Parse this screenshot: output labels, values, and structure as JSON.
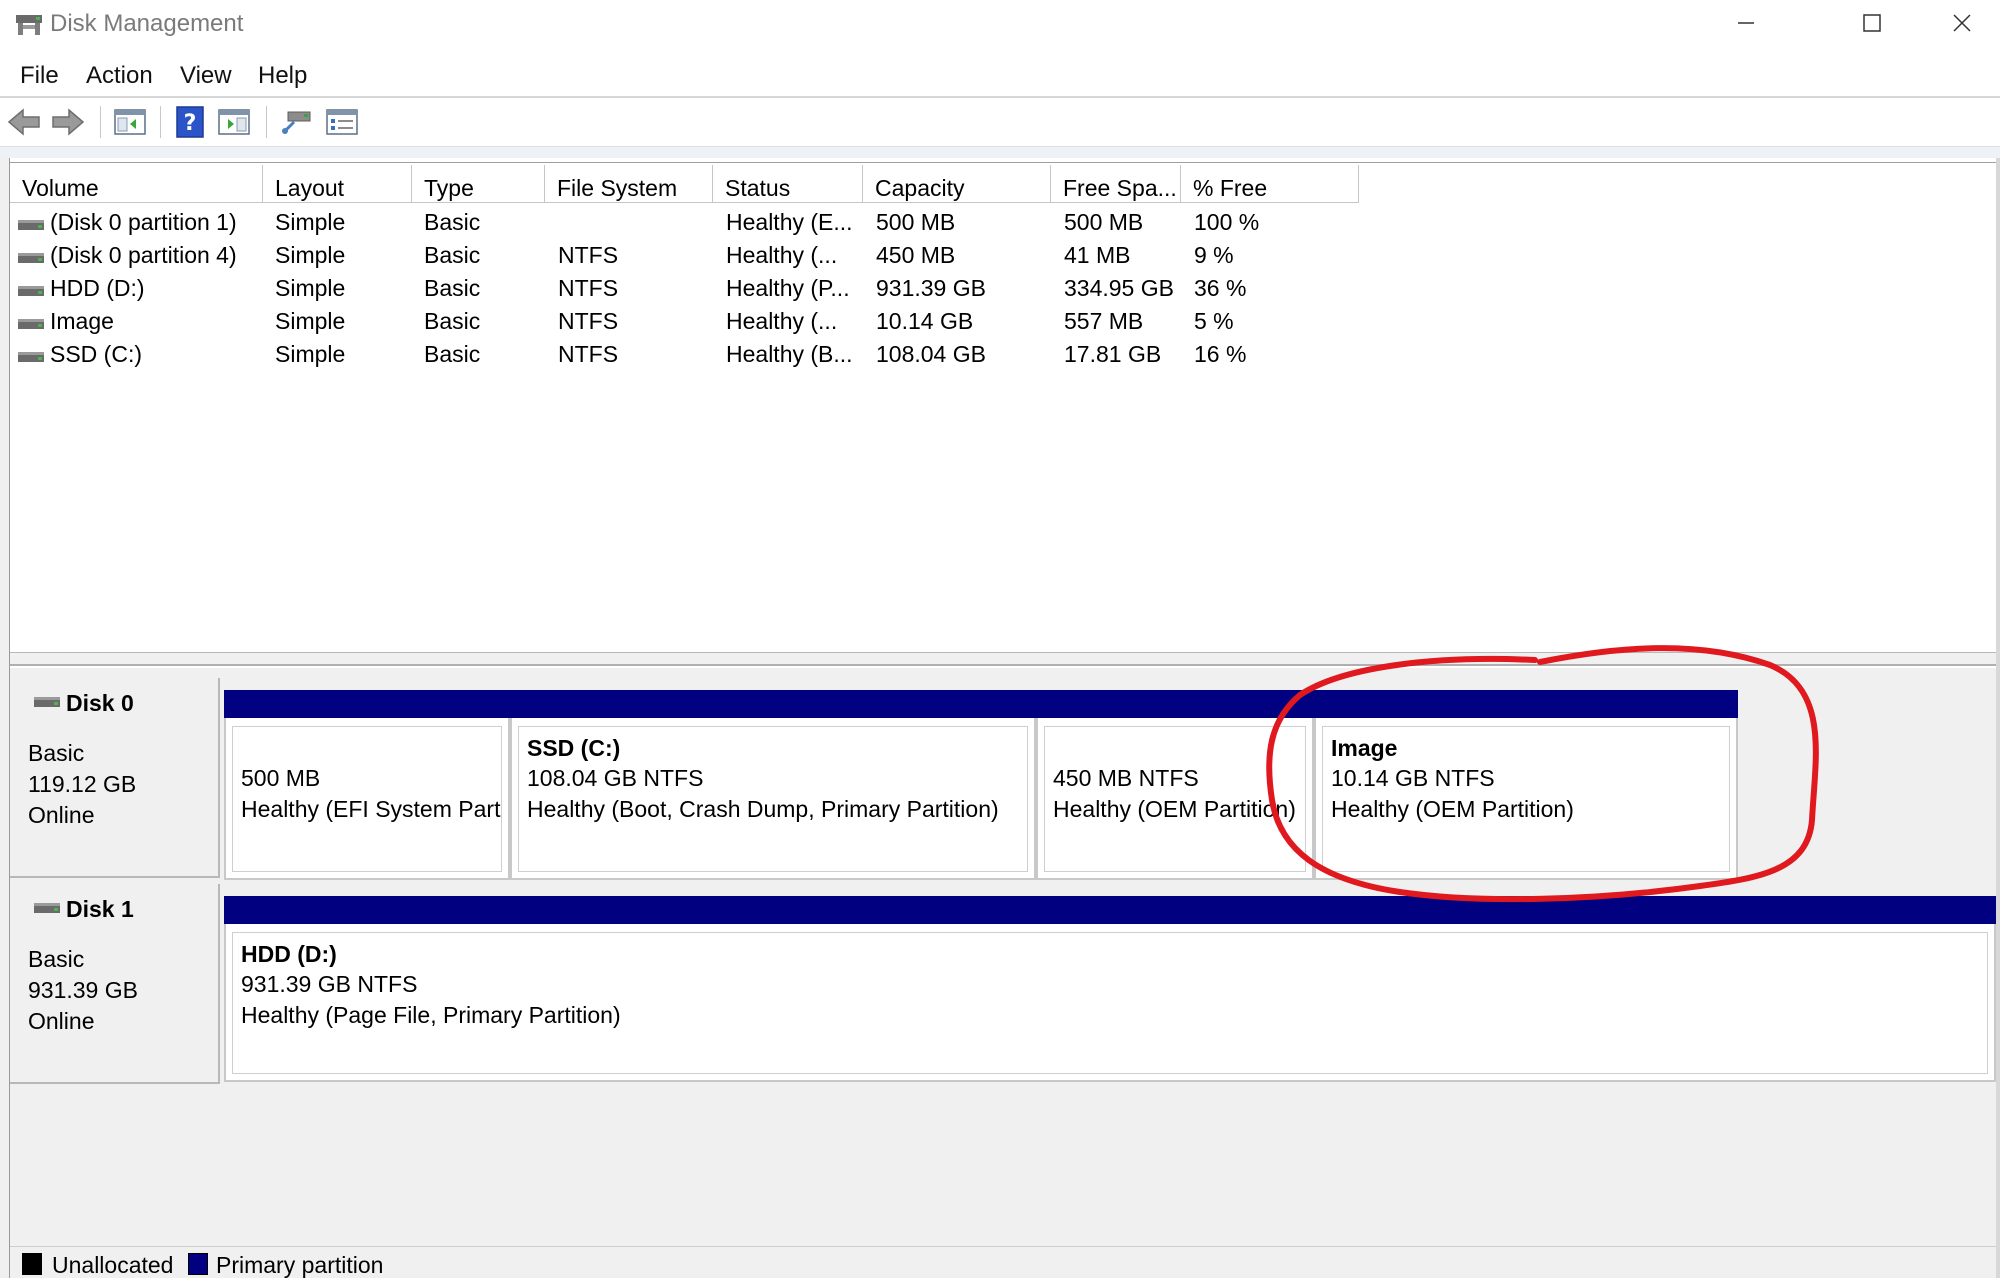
{
  "window": {
    "title": "Disk Management"
  },
  "menu": [
    "File",
    "Action",
    "View",
    "Help"
  ],
  "toolbar": {
    "icons": [
      "back-arrow-icon",
      "forward-arrow-icon",
      "console-tree-icon",
      "help-icon",
      "action-pane-icon",
      "connect-drive-icon",
      "properties-icon"
    ]
  },
  "volume_table": {
    "columns": [
      "Volume",
      "Layout",
      "Type",
      "File System",
      "Status",
      "Capacity",
      "Free Spa...",
      "% Free"
    ],
    "rows": [
      {
        "volume": "(Disk 0 partition 1)",
        "layout": "Simple",
        "type": "Basic",
        "fs": "",
        "status": "Healthy (E...",
        "capacity": "500 MB",
        "free": "500 MB",
        "pct": "100 %"
      },
      {
        "volume": "(Disk 0 partition 4)",
        "layout": "Simple",
        "type": "Basic",
        "fs": "NTFS",
        "status": "Healthy (...",
        "capacity": "450 MB",
        "free": "41 MB",
        "pct": "9 %"
      },
      {
        "volume": "HDD (D:)",
        "layout": "Simple",
        "type": "Basic",
        "fs": "NTFS",
        "status": "Healthy (P...",
        "capacity": "931.39 GB",
        "free": "334.95 GB",
        "pct": "36 %"
      },
      {
        "volume": "Image",
        "layout": "Simple",
        "type": "Basic",
        "fs": "NTFS",
        "status": "Healthy (...",
        "capacity": "10.14 GB",
        "free": "557 MB",
        "pct": "5 %"
      },
      {
        "volume": "SSD (C:)",
        "layout": "Simple",
        "type": "Basic",
        "fs": "NTFS",
        "status": "Healthy (B...",
        "capacity": "108.04 GB",
        "free": "17.81 GB",
        "pct": "16 %"
      }
    ]
  },
  "disks": [
    {
      "name": "Disk 0",
      "type": "Basic",
      "size": "119.12 GB",
      "state": "Online",
      "partitions": [
        {
          "title": "",
          "size": "500 MB",
          "status": "Healthy (EFI System Part"
        },
        {
          "title": "SSD  (C:)",
          "size": "108.04 GB NTFS",
          "status": "Healthy (Boot, Crash Dump, Primary Partition)"
        },
        {
          "title": "",
          "size": "450 MB NTFS",
          "status": "Healthy (OEM Partition)"
        },
        {
          "title": "Image",
          "size": "10.14 GB NTFS",
          "status": "Healthy (OEM Partition)"
        }
      ]
    },
    {
      "name": "Disk 1",
      "type": "Basic",
      "size": "931.39 GB",
      "state": "Online",
      "partitions": [
        {
          "title": "HDD  (D:)",
          "size": "931.39 GB NTFS",
          "status": "Healthy (Page File, Primary Partition)"
        }
      ]
    }
  ],
  "legend": [
    {
      "label": "Unallocated",
      "color": "#000000"
    },
    {
      "label": "Primary partition",
      "color": "#000080"
    }
  ],
  "colors": {
    "partition_header": "#000080",
    "annotation": "#e0191f"
  }
}
